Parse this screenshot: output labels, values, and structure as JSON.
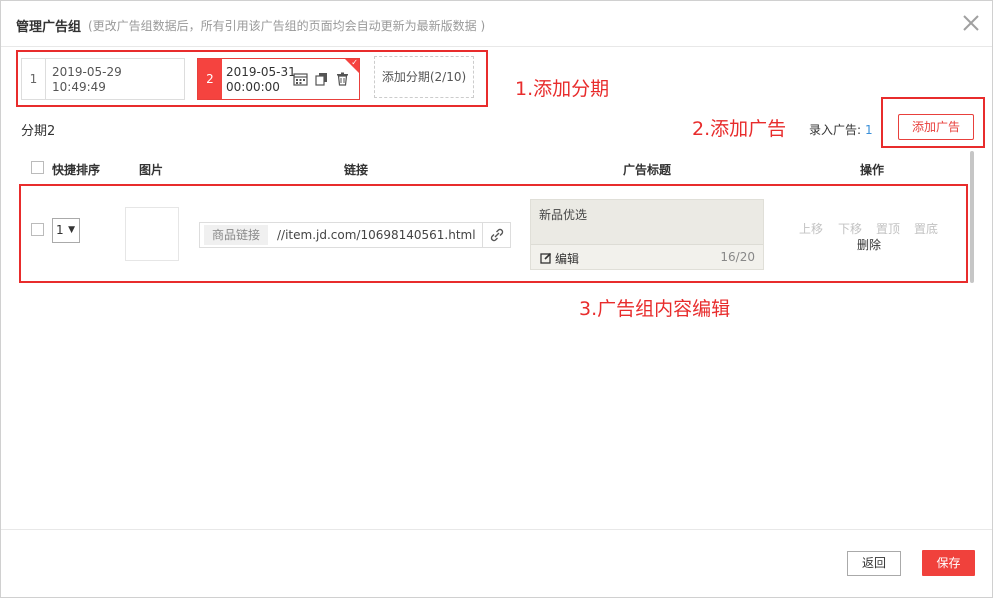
{
  "header": {
    "title": "管理广告组",
    "subtitle": "(更改广告组数据后，所有引用该广告组的页面均会自动更新为最新版数据 )"
  },
  "periods": [
    {
      "num": "1",
      "date": "2019-05-29",
      "time": "10:49:49"
    },
    {
      "num": "2",
      "date": "2019-05-31",
      "time": "00:00:00"
    }
  ],
  "add_period_label": "添加分期(2/10)",
  "annotations": {
    "a1": "1.添加分期",
    "a2": "2.添加广告",
    "a3": "3.广告组内容编辑"
  },
  "current_period_label": "分期2",
  "entered": {
    "label": "录入广告:",
    "count": "1"
  },
  "add_ad_label": "添加广告",
  "columns": {
    "sort": "快捷排序",
    "image": "图片",
    "link": "链接",
    "title": "广告标题",
    "ops": "操作"
  },
  "row": {
    "sort_value": "1",
    "link_prefix": "商品链接",
    "link_value": "//item.jd.com/10698140561.html",
    "ad_title": "新品优选",
    "edit_label": "编辑",
    "char_count": "16/20",
    "ops": {
      "up": "上移",
      "down": "下移",
      "top": "置顶",
      "bottom": "置底",
      "delete": "删除"
    }
  },
  "footer": {
    "back_label": "返回",
    "save_label": "保存"
  },
  "colors": {
    "accent": "#f0413c",
    "annotation": "#e82c2c",
    "count_link": "#3a8fd8"
  }
}
